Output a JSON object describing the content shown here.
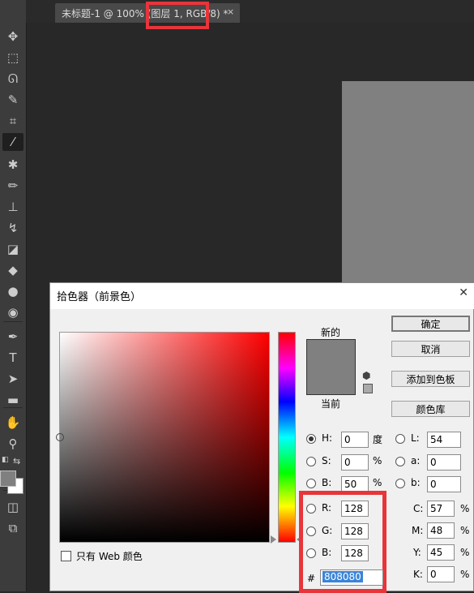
{
  "document_tab": {
    "title": "未标题-1 @ 100% (图层 1, RGB/8) *",
    "close": "×"
  },
  "tools": [
    {
      "icon": "move-tool-icon",
      "glyph": "✥"
    },
    {
      "icon": "marquee-tool-icon",
      "glyph": "⬚"
    },
    {
      "icon": "lasso-tool-icon",
      "glyph": "ᘏ"
    },
    {
      "icon": "quick-select-tool-icon",
      "glyph": "✎"
    },
    {
      "icon": "crop-tool-icon",
      "glyph": "⌗"
    },
    {
      "icon": "eyedropper-tool-icon",
      "glyph": "⁄"
    },
    {
      "icon": "healing-brush-tool-icon",
      "glyph": "✱"
    },
    {
      "icon": "brush-tool-icon",
      "glyph": "✏"
    },
    {
      "icon": "clone-stamp-tool-icon",
      "glyph": "⊥"
    },
    {
      "icon": "history-brush-tool-icon",
      "glyph": "↯"
    },
    {
      "icon": "eraser-tool-icon",
      "glyph": "◪"
    },
    {
      "icon": "paint-bucket-tool-icon",
      "glyph": "◆"
    },
    {
      "icon": "blur-tool-icon",
      "glyph": "●"
    },
    {
      "icon": "dodge-tool-icon",
      "glyph": "◉"
    },
    {
      "icon": "pen-tool-icon",
      "glyph": "✒"
    },
    {
      "icon": "type-tool-icon",
      "glyph": "T"
    },
    {
      "icon": "path-select-tool-icon",
      "glyph": "➤"
    },
    {
      "icon": "rectangle-tool-icon",
      "glyph": "▬"
    },
    {
      "icon": "hand-tool-icon",
      "glyph": "✋"
    },
    {
      "icon": "zoom-tool-icon",
      "glyph": "⚲"
    },
    {
      "icon": "quick-mask-icon",
      "glyph": "◫"
    },
    {
      "icon": "screen-mode-icon",
      "glyph": "⧉"
    }
  ],
  "foreground_color": "#808080",
  "background_color": "#ffffff",
  "dialog": {
    "title": "拾色器（前景色）",
    "close": "✕",
    "new_label": "新的",
    "current_label": "当前",
    "new_color": "#808080",
    "current_color": "#808080",
    "buttons": {
      "ok": "确定",
      "cancel": "取消",
      "add_swatch": "添加到色板",
      "color_libraries": "颜色库"
    },
    "hsb": {
      "h_label": "H:",
      "h_value": "0",
      "h_unit": "度",
      "s_label": "S:",
      "s_value": "0",
      "s_unit": "%",
      "b_label": "B:",
      "b_value": "50",
      "b_unit": "%"
    },
    "rgb": {
      "r_label": "R:",
      "r_value": "128",
      "g_label": "G:",
      "g_value": "128",
      "b_label": "B:",
      "b_value": "128"
    },
    "lab": {
      "l_label": "L:",
      "l_value": "54",
      "a_label": "a:",
      "a_value": "0",
      "b_label": "b:",
      "b_value": "0"
    },
    "cmyk": {
      "c_label": "C:",
      "c_value": "57",
      "m_label": "M:",
      "m_value": "48",
      "y_label": "Y:",
      "y_value": "45",
      "k_label": "K:",
      "k_value": "0",
      "unit": "%"
    },
    "web_only_label": "只有 Web 颜色",
    "hex_hash": "#",
    "hex_value": "808080"
  },
  "highlight_color": "#e8353a"
}
